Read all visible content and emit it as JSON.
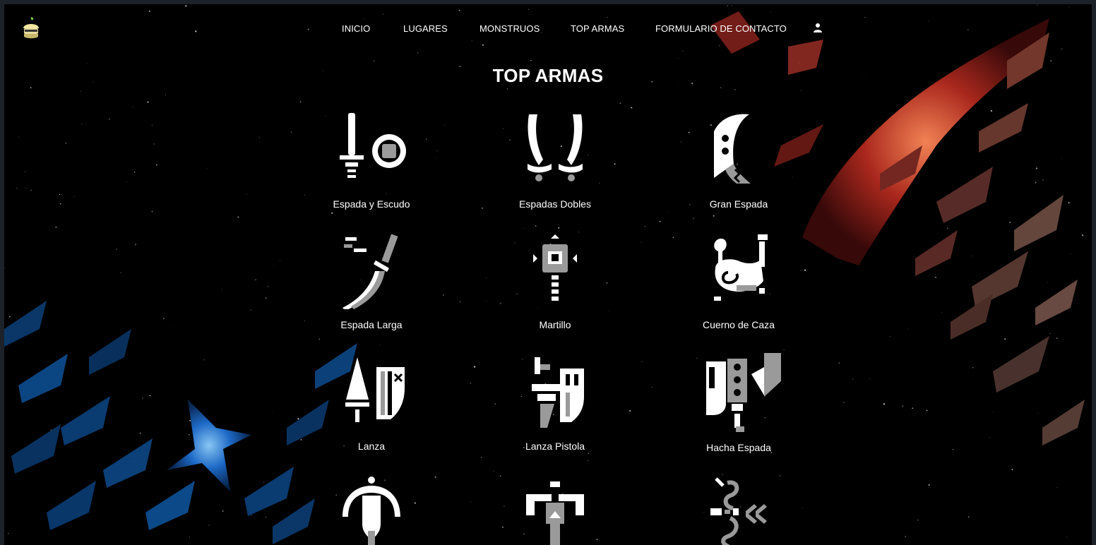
{
  "nav": {
    "logo_icon": "mushroom-logo-icon",
    "links": [
      {
        "label": "INICIO"
      },
      {
        "label": "LUGARES"
      },
      {
        "label": "MONSTRUOS"
      },
      {
        "label": "TOP ARMAS"
      },
      {
        "label": "FORMULARIO DE CONTACTO"
      }
    ],
    "user_icon": "user-icon"
  },
  "page": {
    "title": "TOP ARMAS"
  },
  "weapons": [
    {
      "name": "Espada y Escudo",
      "icon": "sword-and-shield-icon"
    },
    {
      "name": "Espadas Dobles",
      "icon": "dual-blades-icon"
    },
    {
      "name": "Gran Espada",
      "icon": "great-sword-icon"
    },
    {
      "name": "Espada Larga",
      "icon": "long-sword-icon"
    },
    {
      "name": "Martillo",
      "icon": "hammer-icon"
    },
    {
      "name": "Cuerno de Caza",
      "icon": "hunting-horn-icon"
    },
    {
      "name": "Lanza",
      "icon": "lance-icon"
    },
    {
      "name": "Lanza Pistola",
      "icon": "gunlance-icon"
    },
    {
      "name": "Hacha Espada",
      "icon": "switch-axe-icon"
    },
    {
      "name": "",
      "icon": "charge-blade-icon"
    },
    {
      "name": "",
      "icon": "insect-glaive-icon"
    },
    {
      "name": "",
      "icon": "bow-icon"
    }
  ],
  "colors": {
    "background": "#000000",
    "frame": "#1d2129",
    "text": "#ffffff",
    "icon_white": "#ffffff",
    "icon_grey": "#9a9a9a",
    "accent_red": "#c23a2a",
    "accent_blue": "#1f6fd1"
  }
}
